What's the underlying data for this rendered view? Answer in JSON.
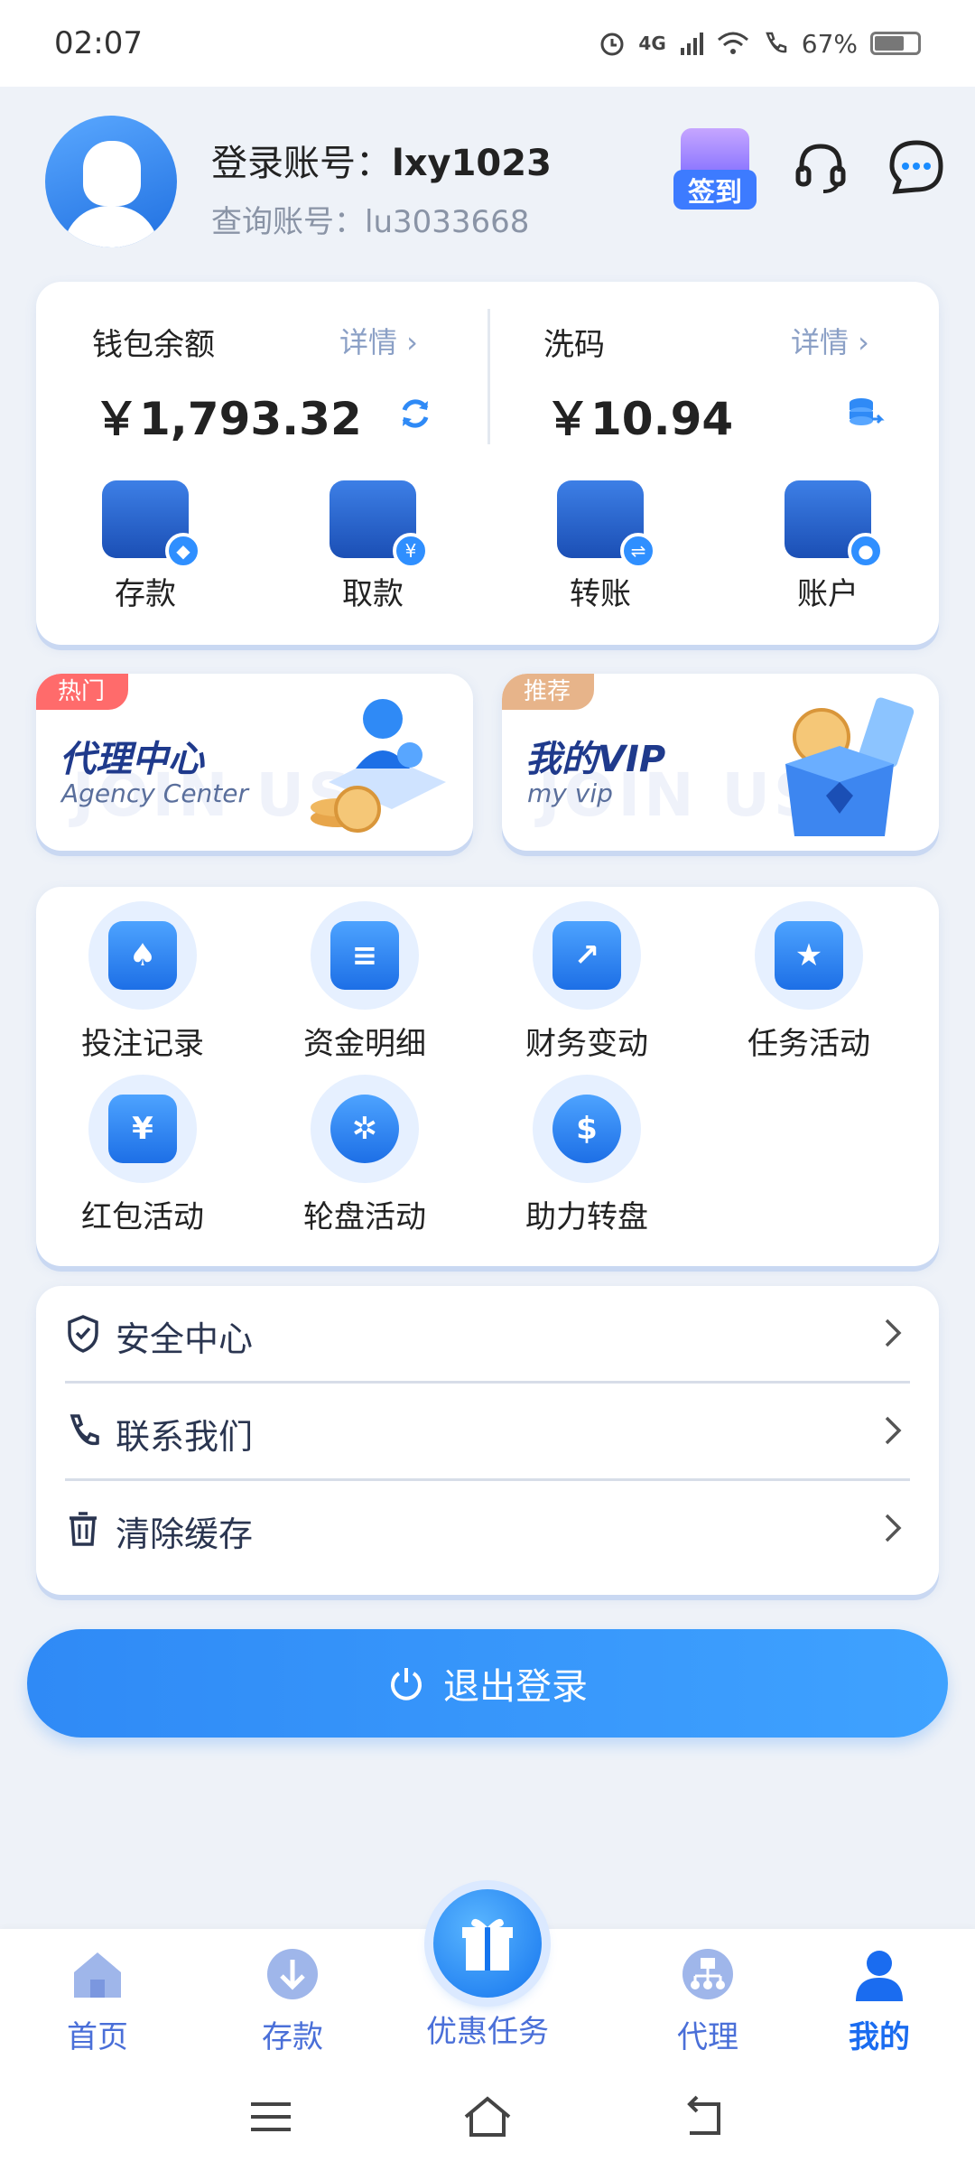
{
  "status_bar": {
    "time": "02:07",
    "network": "4G",
    "battery": "67%",
    "battery_level": 0.67
  },
  "profile": {
    "login_label": "登录账号：",
    "login_value": "lxy1023",
    "query_label": "查询账号：",
    "query_value": "lu3033668",
    "signin_label": "签到"
  },
  "wallet": {
    "balance_label": "钱包余额",
    "balance_detail": "详情 ›",
    "balance_value": "￥1,793.32",
    "wash_label": "洗码",
    "wash_detail": "详情 ›",
    "wash_value": "￥10.94",
    "actions": [
      {
        "label": "存款",
        "icon": "wallet-icon"
      },
      {
        "label": "取款",
        "icon": "card-icon"
      },
      {
        "label": "转账",
        "icon": "transfer-icon"
      },
      {
        "label": "账户",
        "icon": "user-icon"
      }
    ]
  },
  "promos": [
    {
      "tag": "热门",
      "title": "代理中心",
      "subtitle": "Agency Center",
      "watermark": "JOIN US",
      "tag_color": "#ff6b6b"
    },
    {
      "tag": "推荐",
      "title": "我的VIP",
      "subtitle": "my vip",
      "watermark": "JOIN US",
      "tag_color": "#e7b48a"
    }
  ],
  "menu": [
    {
      "label": "投注记录",
      "icon": "spade-card-icon"
    },
    {
      "label": "资金明细",
      "icon": "document-icon"
    },
    {
      "label": "财务变动",
      "icon": "trend-chart-icon"
    },
    {
      "label": "任务活动",
      "icon": "star-calendar-icon"
    },
    {
      "label": "红包活动",
      "icon": "red-packet-icon"
    },
    {
      "label": "轮盘活动",
      "icon": "wheel-icon"
    },
    {
      "label": "助力转盘",
      "icon": "prize-wheel-icon"
    }
  ],
  "settings": [
    {
      "label": "安全中心",
      "icon": "shield-icon"
    },
    {
      "label": "联系我们",
      "icon": "phone-icon"
    },
    {
      "label": "清除缓存",
      "icon": "trash-icon"
    }
  ],
  "logout_label": "退出登录",
  "tabs": [
    {
      "label": "首页",
      "icon": "home-icon"
    },
    {
      "label": "存款",
      "icon": "deposit-icon"
    },
    {
      "label": "优惠任务",
      "icon": "gift-icon"
    },
    {
      "label": "代理",
      "icon": "agent-icon"
    },
    {
      "label": "我的",
      "icon": "profile-icon",
      "active": true
    }
  ],
  "colors": {
    "accent": "#2f8af6",
    "bg": "#eef2f8",
    "tab_text": "#4a6fd8"
  }
}
